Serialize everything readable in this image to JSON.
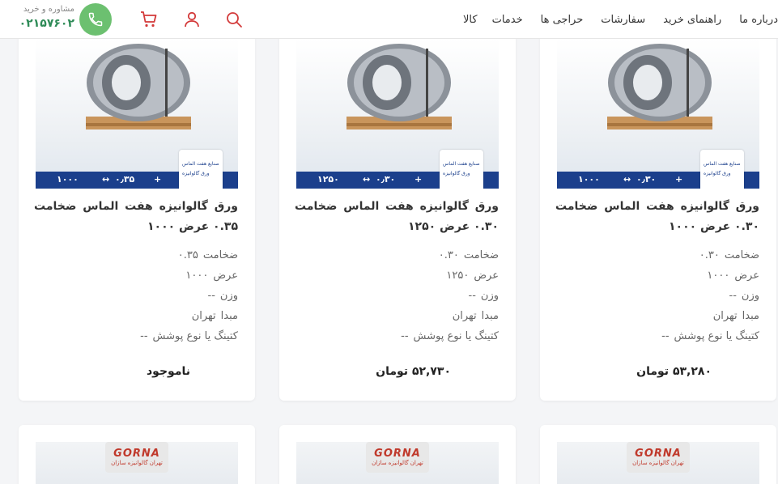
{
  "nav": {
    "items": [
      "درباره ما",
      "راهنمای خرید",
      "سفارشات",
      "حراجی ها",
      "خدمات",
      "کالا"
    ]
  },
  "contact": {
    "label": "مشاوره و خرید",
    "phone": "۰۲۱۵۷۶۰۲"
  },
  "products": [
    {
      "title": "ورق گالوانیزه هفت الماس ضخامت ۰.۳۰ عرض ۱۰۰۰",
      "specs": [
        {
          "k": "ضخامت",
          "v": "۰.۳۰"
        },
        {
          "k": "عرض",
          "v": "۱۰۰۰"
        },
        {
          "k": "وزن",
          "v": "--"
        },
        {
          "k": "مبدا",
          "v": "تهران"
        },
        {
          "k": "کتینگ یا نوع پوشش",
          "v": "--"
        }
      ],
      "price": "۵۳,۲۸۰ تومان",
      "banner": {
        "width": "۱۰۰۰",
        "thickness": "۰٫۳۰"
      }
    },
    {
      "title": "ورق گالوانیزه هفت الماس ضخامت ۰.۳۰ عرض ۱۲۵۰",
      "specs": [
        {
          "k": "ضخامت",
          "v": "۰.۳۰"
        },
        {
          "k": "عرض",
          "v": "۱۲۵۰"
        },
        {
          "k": "وزن",
          "v": "--"
        },
        {
          "k": "مبدا",
          "v": "تهران"
        },
        {
          "k": "کتینگ یا نوع پوشش",
          "v": "--"
        }
      ],
      "price": "۵۲,۷۳۰ تومان",
      "banner": {
        "width": "۱۲۵۰",
        "thickness": "۰٫۳۰"
      }
    },
    {
      "title": "ورق گالوانیزه هفت الماس ضخامت ۰.۳۵ عرض ۱۰۰۰",
      "specs": [
        {
          "k": "ضخامت",
          "v": "۰.۳۵"
        },
        {
          "k": "عرض",
          "v": "۱۰۰۰"
        },
        {
          "k": "وزن",
          "v": "--"
        },
        {
          "k": "مبدا",
          "v": "تهران"
        },
        {
          "k": "کتینگ یا نوع پوشش",
          "v": "--"
        }
      ],
      "price": "ناموجود",
      "banner": {
        "width": "۱۰۰۰",
        "thickness": "۰٫۳۵"
      }
    }
  ],
  "badge": {
    "line1": "صنایع هفت الماس",
    "line2": "ورق گالوانیزه"
  },
  "row2_brand": {
    "name": "GORNA",
    "sub": "تهران گالوانیزه سازان"
  },
  "colors": {
    "green": "#6cc070",
    "blue": "#1b3f8c",
    "brand_red": "#c0392b"
  }
}
